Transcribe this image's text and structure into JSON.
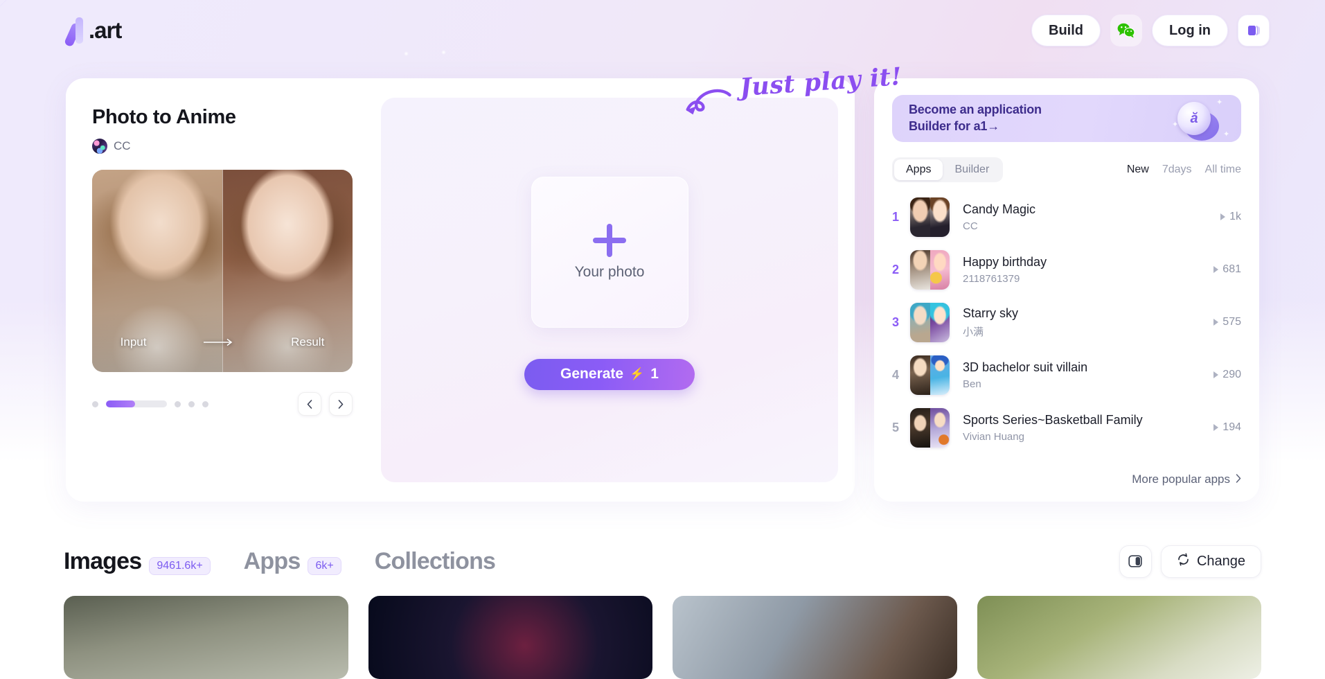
{
  "header": {
    "logo_text": ".art",
    "build_label": "Build",
    "login_label": "Log in",
    "wechat_icon": "wechat-icon",
    "library_icon": "library-icon"
  },
  "app": {
    "title": "Photo to Anime",
    "author": "CC",
    "preview": {
      "input_label": "Input",
      "result_label": "Result"
    },
    "upload": {
      "plus_icon": "plus-icon",
      "label": "Your photo"
    },
    "generate": {
      "label": "Generate",
      "bolt_icon": "bolt-icon",
      "credits": "1"
    }
  },
  "sticker": {
    "text": "Just play it!",
    "arrow_icon": "curved-arrow-icon"
  },
  "promo": {
    "line1": "Become an application",
    "line2": "Builder for a1→",
    "coin_glyph": "ӑ"
  },
  "rank_panel": {
    "segments": [
      {
        "label": "Apps",
        "active": true
      },
      {
        "label": "Builder",
        "active": false
      }
    ],
    "filters": [
      {
        "label": "New",
        "active": true
      },
      {
        "label": "7days",
        "active": false
      },
      {
        "label": "All time",
        "active": false
      }
    ],
    "items": [
      {
        "rank": "1",
        "title": "Candy Magic",
        "author": "CC",
        "plays": "1k"
      },
      {
        "rank": "2",
        "title": "Happy birthday",
        "author": "2118761379",
        "plays": "681"
      },
      {
        "rank": "3",
        "title": "Starry sky",
        "author": "小满",
        "plays": "575"
      },
      {
        "rank": "4",
        "title": "3D bachelor suit villain",
        "author": "Ben",
        "plays": "290"
      },
      {
        "rank": "5",
        "title": "Sports Series~Basketball Family",
        "author": "Vivian Huang",
        "plays": "194"
      }
    ],
    "more_label": "More popular apps",
    "more_icon": "chevron-right-icon"
  },
  "bottom": {
    "tabs": [
      {
        "label": "Images",
        "badge": "9461.6k+",
        "active": true
      },
      {
        "label": "Apps",
        "badge": "6k+",
        "active": false
      },
      {
        "label": "Collections",
        "badge": "",
        "active": false
      }
    ],
    "layout_icon": "layout-panel-icon",
    "change_label": "Change",
    "change_icon": "refresh-icon"
  },
  "colors": {
    "accent": "#8b5cf6",
    "accent_light": "#b07ff7",
    "badge_bg": "#f1ecfe",
    "wechat_green": "#2dc100"
  }
}
